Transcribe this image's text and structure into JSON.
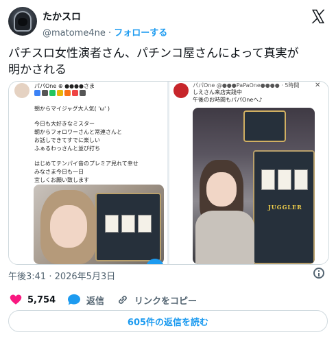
{
  "author": {
    "name": "たかスロ",
    "handle": "@matome4ne",
    "separator": "·",
    "follow_label": "フォローする"
  },
  "tweet": {
    "text_line1": "パチスロ女性演者さん、パチンコ屋さんによって真実が",
    "text_line2": "明かされる"
  },
  "media": {
    "left_post": {
      "header": "パパOne ⊕ ●●●●さま",
      "lines": [
        "朝からマイジャグ大人気( 'ω' )",
        "",
        "今日も大好きなミスター",
        "朝からフォロワーさんと常連さんと",
        "お話しできてすでに楽しい",
        "ふぁるわっさんと並び打ち",
        "",
        "はじめてテンパイ音のプレミア見れて幸せ",
        "みなさま今日も一日",
        "宜しくお願い致します"
      ]
    },
    "right_post": {
      "header": "パパOne @●●●PaPaOne●●●● · 5時間",
      "lines": [
        "しえさん来店実践中",
        "午後のお時間もパパOneへ♪"
      ],
      "machine_label": "JUGGLER"
    }
  },
  "meta": {
    "timestamp": "午後3:41 · 2026年5月3日"
  },
  "actions": {
    "likes": "5,754",
    "reply_label": "返信",
    "copy_link_label": "リンクをコピー"
  },
  "replies_button": "605件の返信を読む",
  "colors": {
    "accent": "#1d9bf0",
    "like": "#f91880",
    "text_secondary": "#536471"
  }
}
